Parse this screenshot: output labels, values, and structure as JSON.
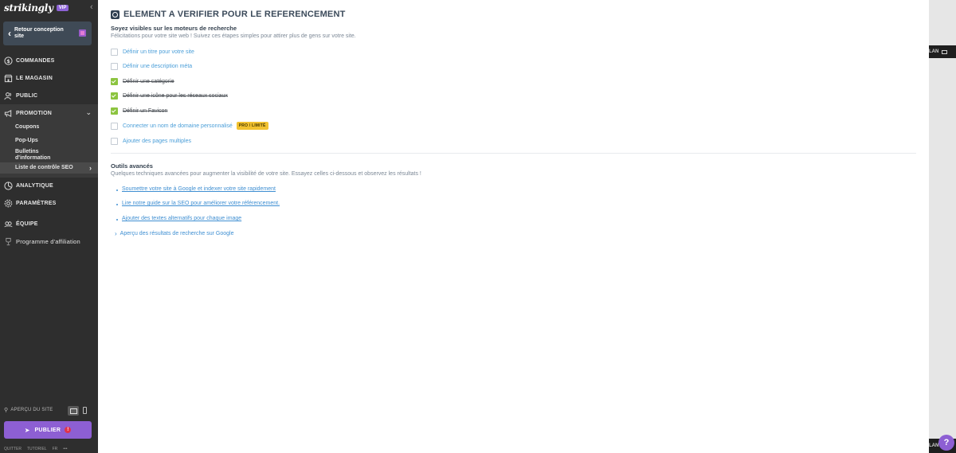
{
  "sidebar": {
    "brand": "strikingly",
    "vip_badge": "VIP",
    "collapse": "‹",
    "back_button": "Retour conception site",
    "nav": {
      "commandes": "COMMANDES",
      "magasin": "LE MAGASIN",
      "public": "PUBLIC",
      "promotion": "PROMOTION",
      "analytique": "ANALYTIQUE",
      "parametres": "PARAMÈTRES",
      "equipe": "ÉQUIPE",
      "affiliation": "Programme d'affiliation"
    },
    "promotion_sub": {
      "coupons": "Coupons",
      "popups": "Pop-Ups",
      "bulletins": "Bulletins d'information",
      "seo": "Liste de contrôle SEO"
    },
    "apercu": "APERÇU DU SITE",
    "publish": "PUBLIER",
    "publish_alert": "!",
    "footer": {
      "quitter": "QUITTER",
      "tutoriel": "TUTORIEL",
      "lang": "FR",
      "more": "•••"
    }
  },
  "main": {
    "title": "ELEMENT A VERIFIER POUR LE REFERENCEMENT",
    "search_section": {
      "heading": "Soyez visibles sur les moteurs de recherche",
      "description": "Félicitations pour votre site web ! Suivez ces étapes simples pour attirer plus de gens sur votre site.",
      "items": [
        {
          "label": "Définir un titre pour votre site",
          "checked": false
        },
        {
          "label": "Définir une description méta",
          "checked": false
        },
        {
          "label": "Définir une catégorie",
          "checked": true
        },
        {
          "label": "Définir une icône pour les réseaux sociaux",
          "checked": true
        },
        {
          "label": "Définir un Favicon",
          "checked": true
        },
        {
          "label": "Connecter un nom de domaine personnalisé",
          "checked": false,
          "badge": "PRO / LIMITÉ"
        },
        {
          "label": "Ajouter des pages multiples",
          "checked": false
        }
      ]
    },
    "tools_section": {
      "heading": "Outils avancés",
      "description": "Quelques techniques avancées pour augmenter la visibilité de votre site. Essayez celles ci-dessous et observez les résultats !",
      "links": [
        "Soumettre votre site à Google et indexer votre site rapidement",
        "Lire notre guide sur la SEO pour améliorer votre référencement.",
        "Ajouter des textes alternatifs pour chaque image"
      ],
      "expand": "Aperçu des résultats de recherche sur Google"
    }
  },
  "preview": {
    "top_bar_text": "LAN",
    "bottom_bar_text": "LAN",
    "help": "?"
  },
  "colors": {
    "sidebar_bg": "#2e2e2e",
    "accent_purple": "#8d5fd3",
    "check_green": "#8cc43f",
    "link_blue": "#3f8fd2",
    "badge_yellow": "#f2c230"
  }
}
